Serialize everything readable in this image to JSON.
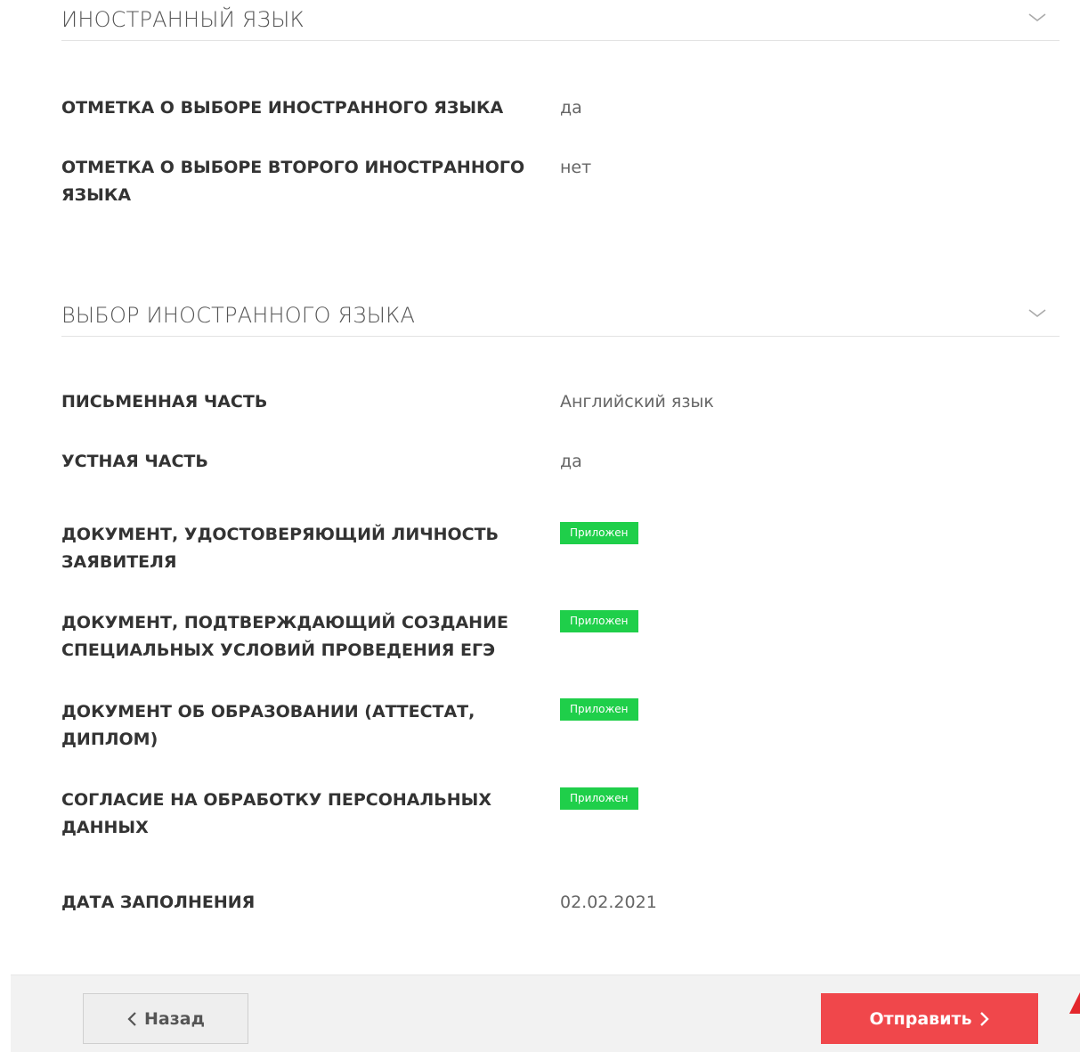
{
  "sections": [
    {
      "title": "ИНОСТРАННЫЙ ЯЗЫК",
      "rows": [
        {
          "label": "ОТМЕТКА О ВЫБОРЕ ИНОСТРАННОГО ЯЗЫКА",
          "value": "да"
        },
        {
          "label": "ОТМЕТКА О ВЫБОРЕ ВТОРОГО ИНОСТРАННОГО ЯЗЫКА",
          "value": "нет"
        }
      ]
    },
    {
      "title": "ВЫБОР ИНОСТРАННОГО ЯЗЫКА",
      "rows": [
        {
          "label": "ПИСЬМЕННАЯ ЧАСТЬ",
          "value": "Английский язык"
        },
        {
          "label": "УСТНАЯ ЧАСТЬ",
          "value": "да"
        },
        {
          "label": "ДОКУМЕНТ, УДОСТОВЕРЯЮЩИЙ ЛИЧНОСТЬ ЗАЯВИТЕЛЯ",
          "badge": "Приложен"
        },
        {
          "label": "ДОКУМЕНТ, ПОДТВЕРЖДАЮЩИЙ СОЗДАНИЕ СПЕЦИАЛЬНЫХ УСЛОВИЙ ПРОВЕДЕНИЯ ЕГЭ",
          "badge": "Приложен"
        },
        {
          "label": "ДОКУМЕНТ ОБ ОБРАЗОВАНИИ (АТТЕСТАТ, ДИПЛОМ)",
          "badge": "Приложен"
        },
        {
          "label": "СОГЛАСИЕ НА ОБРАБОТКУ ПЕРСОНАЛЬНЫХ ДАННЫХ",
          "badge": "Приложен"
        },
        {
          "label": "ДАТА ЗАПОЛНЕНИЯ",
          "value": "02.02.2021"
        }
      ]
    }
  ],
  "footer": {
    "back_label": "Назад",
    "send_label": "Отправить"
  },
  "icons": {
    "chevron": "chevron-down-icon",
    "back": "chevron-left-icon",
    "send": "chevron-right-icon"
  },
  "colors": {
    "badge": "#1fcf4a",
    "send_button": "#f0474b",
    "corner_mark": "#e3262b"
  }
}
